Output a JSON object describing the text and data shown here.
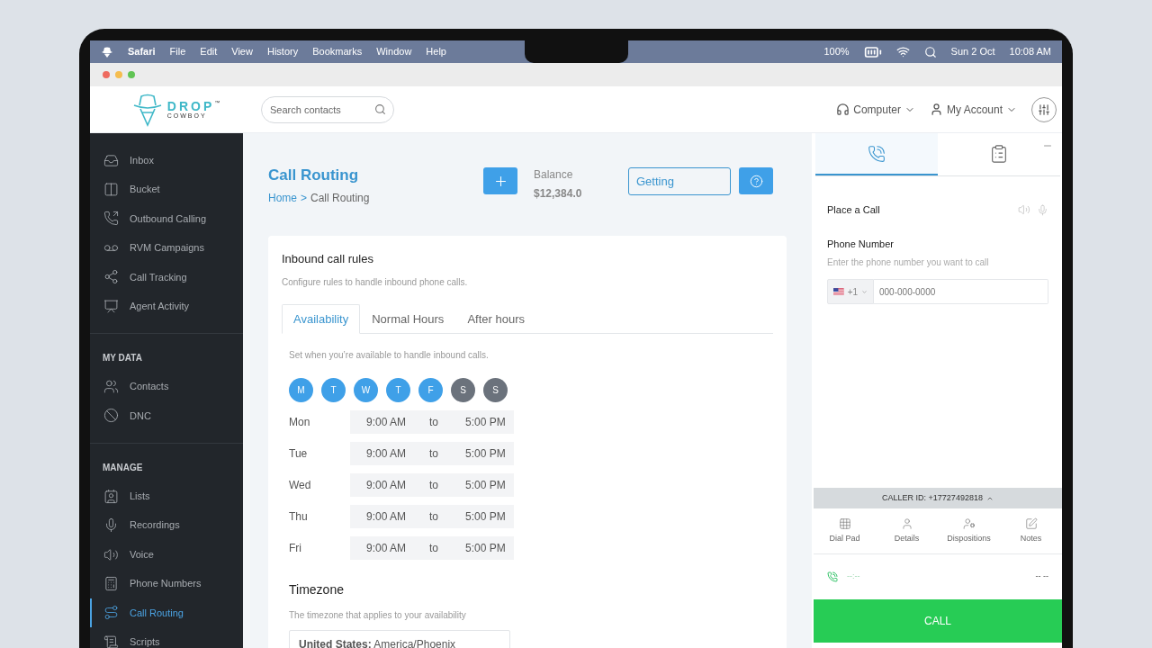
{
  "menubar": {
    "app": "Safari",
    "menus": [
      "File",
      "Edit",
      "View",
      "History",
      "Bookmarks",
      "Window",
      "Help"
    ],
    "battery": "100%",
    "date": "Sun 2 Oct",
    "time": "10:08 AM"
  },
  "header": {
    "logo": {
      "word1": "DROP",
      "word2": "COWBOY",
      "mark": "™"
    },
    "search": {
      "placeholder": "Search contacts"
    },
    "device": "Computer",
    "account": "My Account"
  },
  "sidebar": {
    "sections": [
      {
        "items": [
          {
            "label": "Inbox",
            "selected": false
          },
          {
            "label": "Bucket",
            "selected": false
          },
          {
            "label": "Outbound Calling",
            "selected": false
          },
          {
            "label": "RVM Campaigns",
            "selected": false
          },
          {
            "label": "Call Tracking",
            "selected": false
          },
          {
            "label": "Agent Activity",
            "selected": false
          }
        ]
      },
      {
        "heading": "MY DATA",
        "items": [
          {
            "label": "Contacts",
            "selected": false
          },
          {
            "label": "DNC",
            "selected": false
          }
        ]
      },
      {
        "heading": "MANAGE",
        "items": [
          {
            "label": "Lists",
            "selected": false
          },
          {
            "label": "Recordings",
            "selected": false
          },
          {
            "label": "Voice",
            "selected": false
          },
          {
            "label": "Phone Numbers",
            "selected": false
          },
          {
            "label": "Call Routing",
            "selected": true
          },
          {
            "label": "Scripts",
            "selected": false
          }
        ]
      }
    ]
  },
  "page": {
    "title": "Call Routing",
    "breadcrumb": {
      "home": "Home",
      "separator": ">",
      "current": "Call Routing"
    },
    "balance": {
      "label": "Balance",
      "value": "$12,384.0"
    },
    "status_field": "Getting"
  },
  "card": {
    "title": "Inbound call rules",
    "subtitle": "Configure rules to handle inbound phone calls.",
    "tabs": [
      {
        "label": "Availability",
        "selected": true
      },
      {
        "label": "Normal Hours",
        "selected": false
      },
      {
        "label": "After hours",
        "selected": false
      }
    ],
    "hint": "Set when you’re available to handle inbound calls.",
    "days": [
      {
        "letter": "M",
        "selected": true
      },
      {
        "letter": "T",
        "selected": true
      },
      {
        "letter": "W",
        "selected": true
      },
      {
        "letter": "T",
        "selected": true
      },
      {
        "letter": "F",
        "selected": true
      },
      {
        "letter": "S",
        "selected": false
      },
      {
        "letter": "S",
        "selected": false
      }
    ],
    "schedule": [
      {
        "day": "Mon",
        "start": "9:00 AM",
        "to": "to",
        "end": "5:00 PM"
      },
      {
        "day": "Tue",
        "start": "9:00 AM",
        "to": "to",
        "end": "5:00 PM"
      },
      {
        "day": "Wed",
        "start": "9:00 AM",
        "to": "to",
        "end": "5:00 PM"
      },
      {
        "day": "Thu",
        "start": "9:00 AM",
        "to": "to",
        "end": "5:00 PM"
      },
      {
        "day": "Fri",
        "start": "9:00 AM",
        "to": "to",
        "end": "5:00 PM"
      }
    ],
    "timezone": {
      "title": "Timezone",
      "hint": "The timezone that applies to your availability",
      "value": "**United States:** America/Phoenix"
    }
  },
  "dialer": {
    "tabs": [
      {
        "selected": true
      },
      {
        "selected": false
      }
    ],
    "title": "Place a Call",
    "phone_label": "Phone Number",
    "phone_hint": "Enter the phone number you want to call",
    "country_code": "+1",
    "phone_placeholder": "000-000-0000",
    "caller_id": "CALLER ID: +17727492818",
    "actions": [
      "Dial Pad",
      "Details",
      "Dispositions",
      "Notes"
    ],
    "timer": "--:--",
    "status": "-- --",
    "call_button": "CALL"
  }
}
